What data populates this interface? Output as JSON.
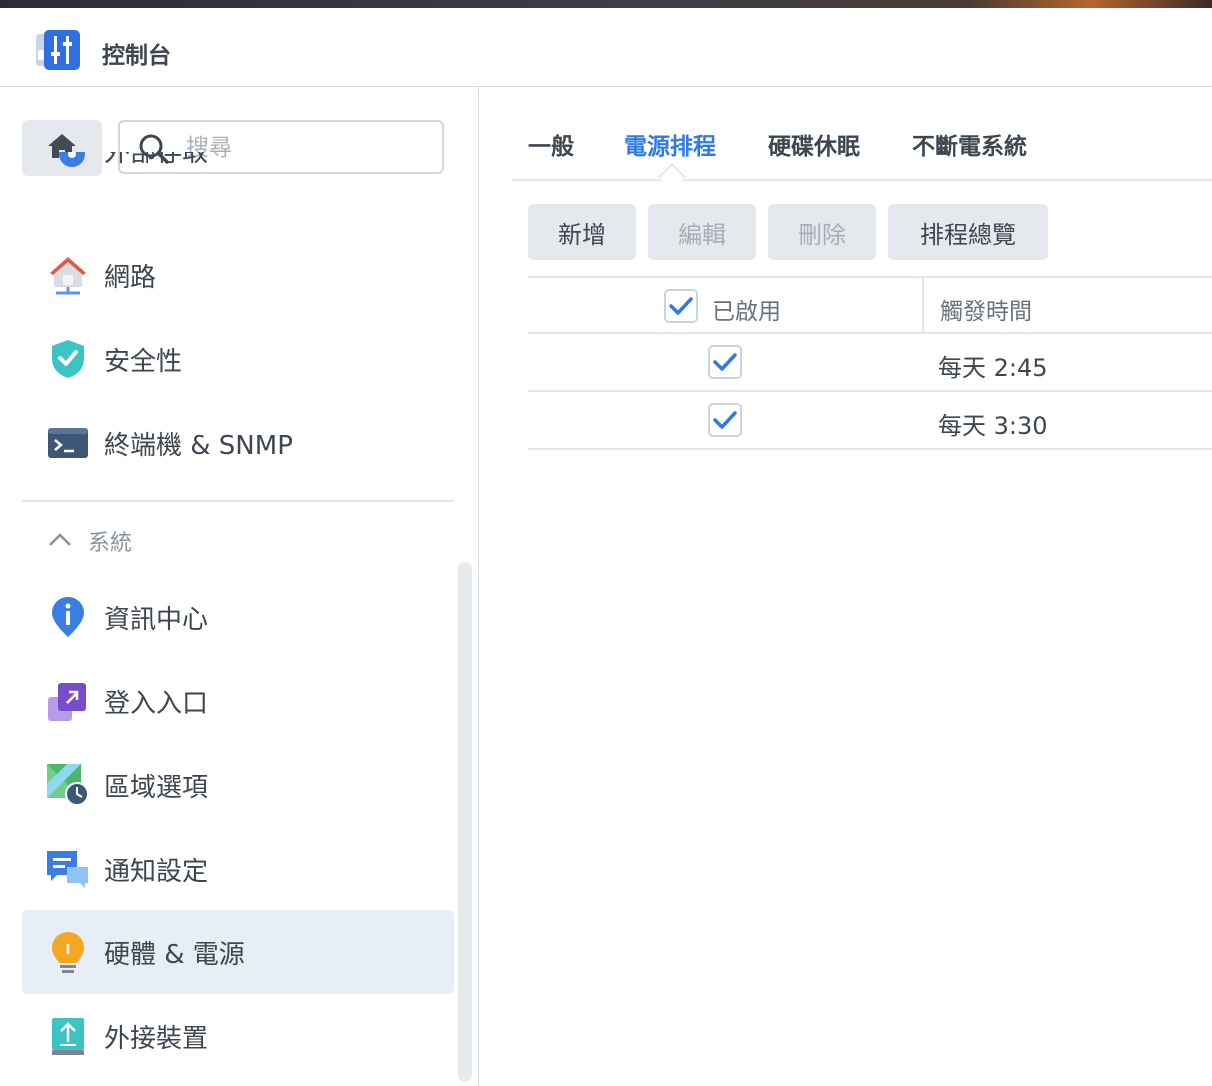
{
  "window": {
    "title": "控制台",
    "app_icon": "control-panel-icon"
  },
  "search": {
    "placeholder": "搜尋"
  },
  "sidebar": {
    "items_top": [
      {
        "label": "外部存取",
        "icon": "external-access-icon"
      },
      {
        "label": "網路",
        "icon": "network-icon"
      },
      {
        "label": "安全性",
        "icon": "security-shield-icon"
      },
      {
        "label": "終端機 & SNMP",
        "icon": "terminal-icon"
      }
    ],
    "section": {
      "label": "系統",
      "expanded": true
    },
    "items_system": [
      {
        "label": "資訊中心",
        "icon": "info-icon"
      },
      {
        "label": "登入入口",
        "icon": "login-portal-icon"
      },
      {
        "label": "區域選項",
        "icon": "regional-options-icon"
      },
      {
        "label": "通知設定",
        "icon": "notification-icon"
      },
      {
        "label": "硬體 & 電源",
        "icon": "hardware-power-icon",
        "active": true
      },
      {
        "label": "外接裝置",
        "icon": "external-devices-icon"
      }
    ]
  },
  "tabs": [
    {
      "label": "一般"
    },
    {
      "label": "電源排程",
      "active": true
    },
    {
      "label": "硬碟休眠"
    },
    {
      "label": "不斷電系統"
    }
  ],
  "toolbar": {
    "add": "新增",
    "edit": "編輯",
    "delete": "刪除",
    "overview": "排程總覽"
  },
  "table": {
    "columns": [
      "已啟用",
      "觸發時間"
    ],
    "rows": [
      {
        "enabled": true,
        "time": "每天 2:45"
      },
      {
        "enabled": true,
        "time": "每天 3:30"
      }
    ]
  },
  "colors": {
    "accent": "#2e7ae6",
    "active_row": "#e8eef8",
    "button_bg": "#e5e8ec"
  }
}
